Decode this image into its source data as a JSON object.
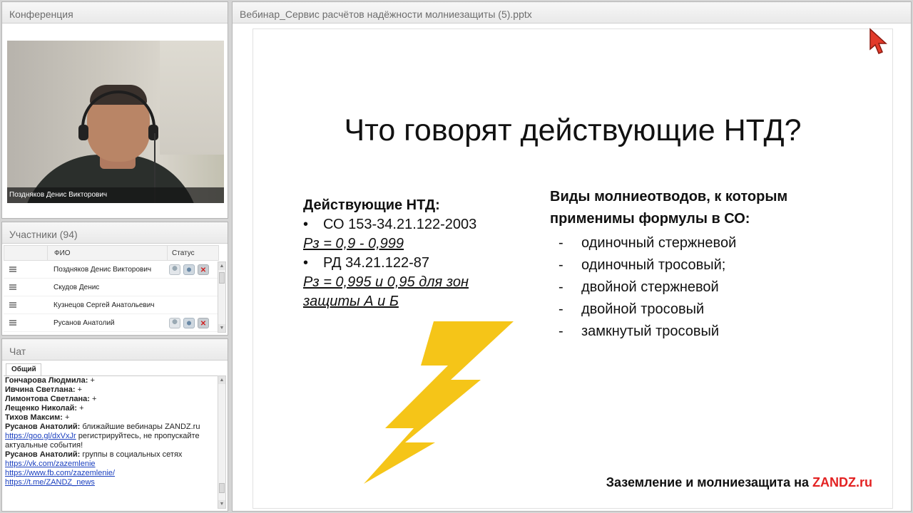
{
  "conference": {
    "title": "Конференция",
    "video_caption": "Поздняков Денис  Викторович"
  },
  "participants": {
    "title": "Участники (94)",
    "columns": {
      "name": "ФИО",
      "status": "Статус"
    },
    "rows": [
      {
        "name": "Поздняков Денис  Викторович",
        "status_icons": [
          "user-icon",
          "camera-icon",
          "mic-off-icon"
        ]
      },
      {
        "name": "Скудов Денис",
        "status_icons": []
      },
      {
        "name": "Кузнецов Сергей  Анатольевич",
        "status_icons": []
      },
      {
        "name": "Русанов Анатолий",
        "status_icons": [
          "user-icon",
          "camera-icon",
          "mic-off-icon"
        ]
      }
    ]
  },
  "chat": {
    "title": "Чат",
    "tab": "Общий",
    "messages": [
      {
        "author": "Гончарова Людмила:",
        "text": "+"
      },
      {
        "author": "Ивчина Светлана:",
        "text": "+"
      },
      {
        "author": "Лимонтова Светлана:",
        "text": "+"
      },
      {
        "author": "Лещенко Николай:",
        "text": "+"
      },
      {
        "author": "Тихов Максим:",
        "text": "+"
      },
      {
        "author": "Русанов Анатолий:",
        "text_before": "ближайшие вебинары ZANDZ.ru",
        "link": "https://goo.gl/dxVxJr",
        "text_after": "регистрируйтесь, не пропускайте актуальные события!"
      },
      {
        "author": "Русанов Анатолий:",
        "text": "группы в социальных сетях",
        "links": [
          "https://vk.com/zazemlenie",
          "https://www.fb.com/zazemlenie/",
          "https://t.me/ZANDZ_news"
        ]
      }
    ]
  },
  "presentation": {
    "title": "Вебинар_Сервис расчётов надёжности молниезащиты (5).pptx",
    "slide": {
      "heading": "Что говорят действующие НТД?",
      "left_header": "Действующие  НТД:",
      "left_items": [
        {
          "type": "bullet",
          "text": "СО 153-34.21.122-2003"
        },
        {
          "type": "formula",
          "text": "Рз = 0,9 - 0,999"
        },
        {
          "type": "bullet",
          "text": "РД 34.21.122-87"
        },
        {
          "type": "formula",
          "text": "Рз = 0,995 и 0,95 для зон защиты А и Б"
        }
      ],
      "right_header": "Виды молниеотводов, к которым применимы формулы в СО:",
      "right_items": [
        "одиночный стержневой",
        "одиночный тросовый;",
        "двойной стержневой",
        "двойной тросовый",
        "замкнутый тросовый"
      ],
      "footer_text": "Заземление и молниезащита на",
      "footer_brand": "ZANDZ.ru",
      "bolt_color": "#f5c518"
    }
  }
}
